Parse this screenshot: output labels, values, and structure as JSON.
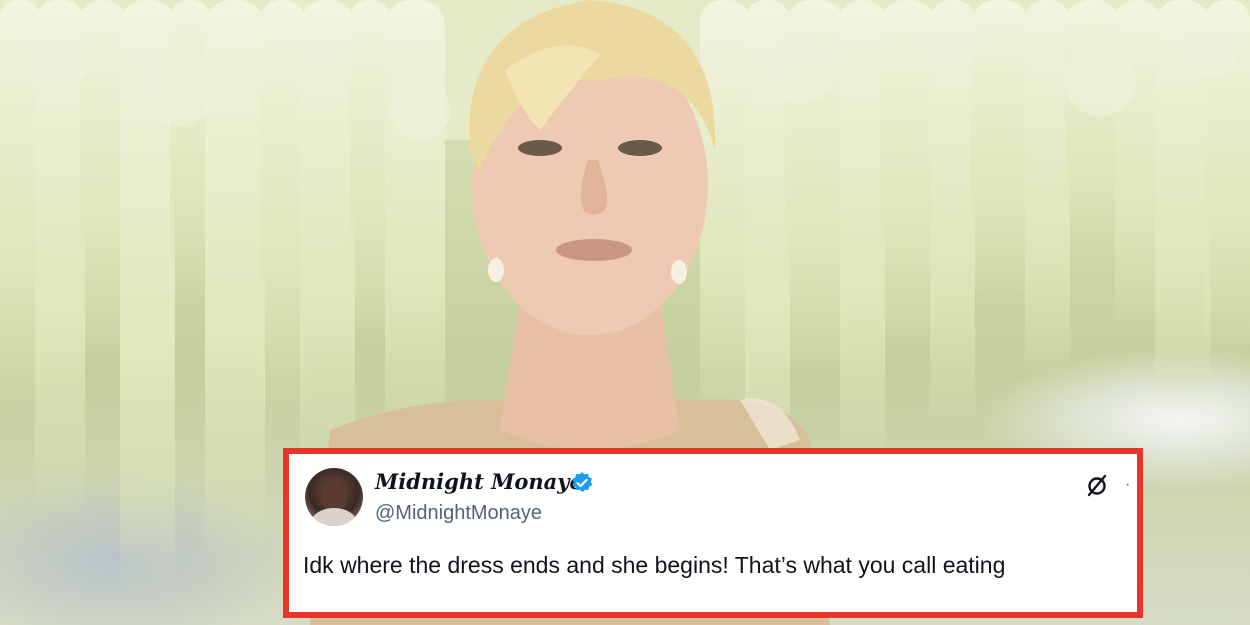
{
  "tweet": {
    "display_name": "Midnight Monaye",
    "handle": "@MidnightMonaye",
    "text": "Idk where the dress ends and she begins! That’s what you call eating",
    "verified": true,
    "more_glyph": "·"
  },
  "colors": {
    "card_border": "#e8352c",
    "verified_badge": "#1d9bf0",
    "handle_text": "#536471",
    "body_text": "#0f1419"
  },
  "icons": [
    "verified-badge-icon",
    "x-logo-icon",
    "more-options-icon"
  ]
}
